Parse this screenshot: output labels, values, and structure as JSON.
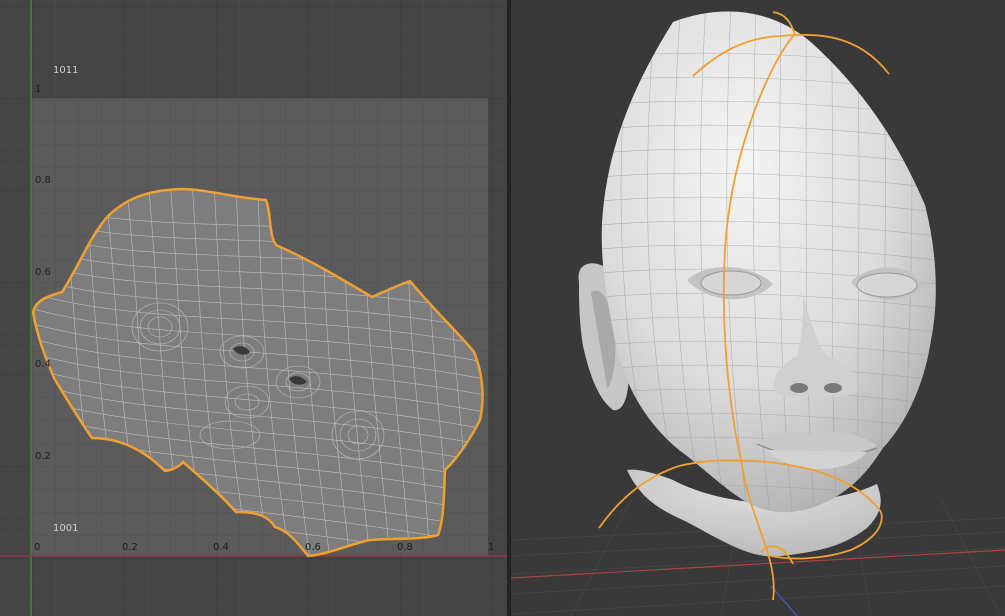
{
  "uv_editor": {
    "tile_labels": [
      "1011",
      "1001"
    ],
    "v_ticks": [
      "1",
      "0.8",
      "0.6",
      "0.4",
      "0.2"
    ],
    "u_ticks": [
      "0",
      "0.2",
      "0.4",
      "0.6",
      "0.8",
      "1"
    ],
    "colors": {
      "selection": "#f0a030",
      "udim_tile": "#5c5c5c",
      "grid_line": "#505050",
      "island_fill": "#7d7d7d",
      "mesh_wire": "#c8c8c8",
      "v_axis": "#3a8a3a",
      "u_axis": "#8a3a3a"
    }
  },
  "viewport_3d": {
    "object": "baby-head-mesh",
    "colors": {
      "background": "#393939",
      "floor_grid": "#444444",
      "x_axis": "#a84444",
      "y_axis": "#4a5ad0",
      "skin": "#dcdcdc",
      "wire": "#9c9c9c",
      "seam": "#f0a030"
    }
  }
}
